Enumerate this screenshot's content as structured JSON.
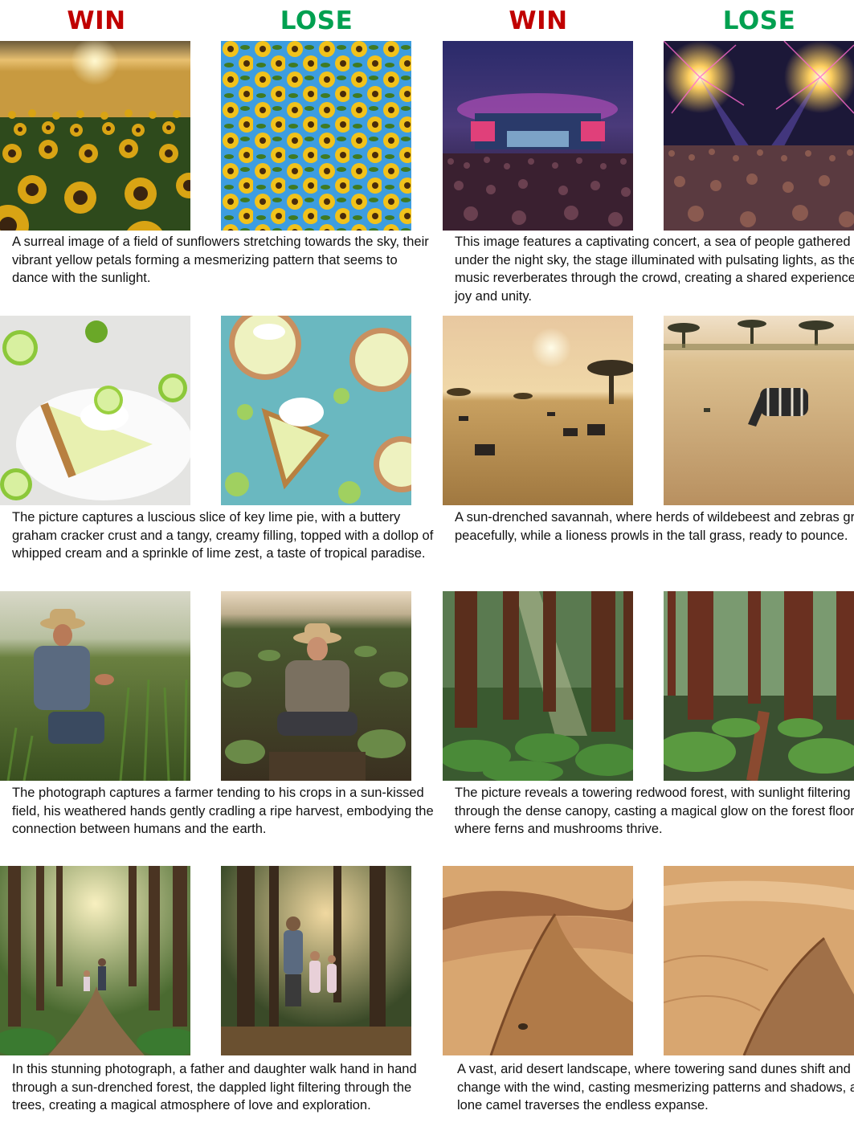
{
  "headers": {
    "left_win": "WIN",
    "left_lose": "LOSE",
    "right_win": "WIN",
    "right_lose": "LOSE",
    "win_color": "#c00000",
    "lose_color": "#00a050"
  },
  "rows": [
    {
      "left_caption": "A surreal image of a field of sunflowers stretching towards the sky, their vibrant yellow petals forming a mesmerizing pattern that seems to dance with the sunlight.",
      "right_caption": "This image features a captivating concert, a sea of people gathered under the night sky, the stage illuminated with pulsating lights, as the music reverberates through the crowd, creating a shared experience of joy and unity."
    },
    {
      "left_caption": "The picture captures a luscious slice of key lime pie, with a buttery graham cracker crust and a tangy, creamy filling, topped with a dollop of whipped cream and a sprinkle of lime zest, a taste of tropical paradise.",
      "right_caption": "A sun-drenched savannah, where herds of wildebeest and zebras graze peacefully, while a lioness prowls in the tall grass, ready to pounce."
    },
    {
      "left_caption": "The photograph captures a farmer tending to his crops in a sun-kissed field, his weathered hands gently cradling a ripe harvest, embodying the connection between humans and the earth.",
      "right_caption": "The picture reveals a towering redwood forest, with sunlight filtering through the dense canopy, casting a magical glow on the forest floor, where ferns and mushrooms thrive."
    },
    {
      "left_caption": "In this stunning photograph, a father and daughter walk hand in hand through a sun-drenched forest, the dappled light filtering through the trees, creating a magical atmosphere of love and exploration.",
      "right_caption": "A vast, arid desert landscape, where towering sand dunes shift and change with the wind, casting mesmerizing patterns and shadows, as a lone camel traverses the endless expanse."
    }
  ]
}
